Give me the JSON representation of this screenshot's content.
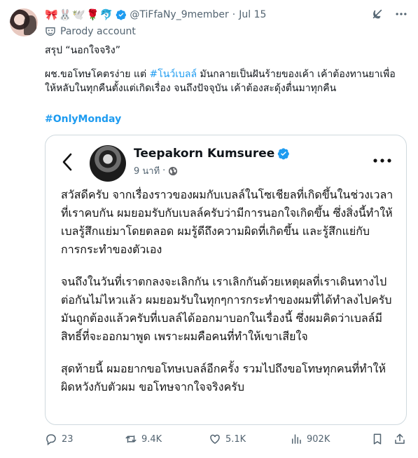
{
  "tweet": {
    "emojis": "🎀🐰🕊️🌹🐬",
    "handle": "@TiFfaNy_9member",
    "time": "Jul 15",
    "parody_label": "Parody account",
    "line1": "สรุป “นอกใจจริง”",
    "line2_part1": "ผช.ขอโทษโคตรง่าย แต่ ",
    "line2_hashtag": "#โนว์เบลล์",
    "line2_part2": " มันกลายเป็นฝันร้ายของเค้า เค้าต้องทานยาเพื่อให้หลับในทุกคืนตั้งแต่เกิดเรื่อง จนถึงปัจจุบัน เค้าต้องสะดุ้งตื่นมาทุกคืน",
    "hashtag2": "#OnlyMonday"
  },
  "card": {
    "name": "Teepakorn Kumsuree",
    "time": "9 นาที",
    "dot": "·",
    "para1": "สวัสดีครับ จากเรื่องราวของผมกับเบลล์ในโซเชียลที่เกิดขึ้นในช่วงเวลาที่เราคบกัน ผมยอมรับกับเบลล์ครับว่ามีการนอกใจเกิดขึ้น ซึ่งสิ่งนี้ทำให้เบลรู้สึกแย่มาโดยตลอด ผมรู้ดีถึงความผิดที่เกิดขึ้น และรู้สึกแย่กับการกระทำของตัวเอง",
    "para2": "จนถึงในวันที่เราตกลงจะเลิกกัน เราเลิกกันด้วยเหตุผลที่เราเดินทางไปต่อกันไม่ไหวแล้ว ผมยอมรับในทุกๆการกระทำของผมที่ได้ทำลงไปครับ มันถูกต้องแล้วครับที่เบลล์ได้ออกมาบอกในเรื่องนี้ ซึ่งผมคิดว่าเบลล์มีสิทธิ์ที่จะออกมาพูด เพราะผมคือคนที่ทำให้เขาเสียใจ",
    "para3": "สุดท้ายนี้ ผมอยากขอโทษเบลล์อีกครั้ง รวมไปถึงขอโทษทุกคนที่ทำให้ผิดหวังกับตัวผม ขอโทษจากใจจริงครับ"
  },
  "actions": {
    "replies": "23",
    "reposts": "9.4K",
    "likes": "5.1K",
    "views": "902K"
  },
  "colors": {
    "accent": "#1d9bf0",
    "muted": "#536471",
    "border": "#cfd9de"
  },
  "icons": [
    "verified-icon",
    "grok-icon",
    "more-icon",
    "mask-icon",
    "back-arrow-icon",
    "globe-icon",
    "reply-icon",
    "repost-icon",
    "like-icon",
    "views-icon",
    "bookmark-icon",
    "share-icon"
  ]
}
